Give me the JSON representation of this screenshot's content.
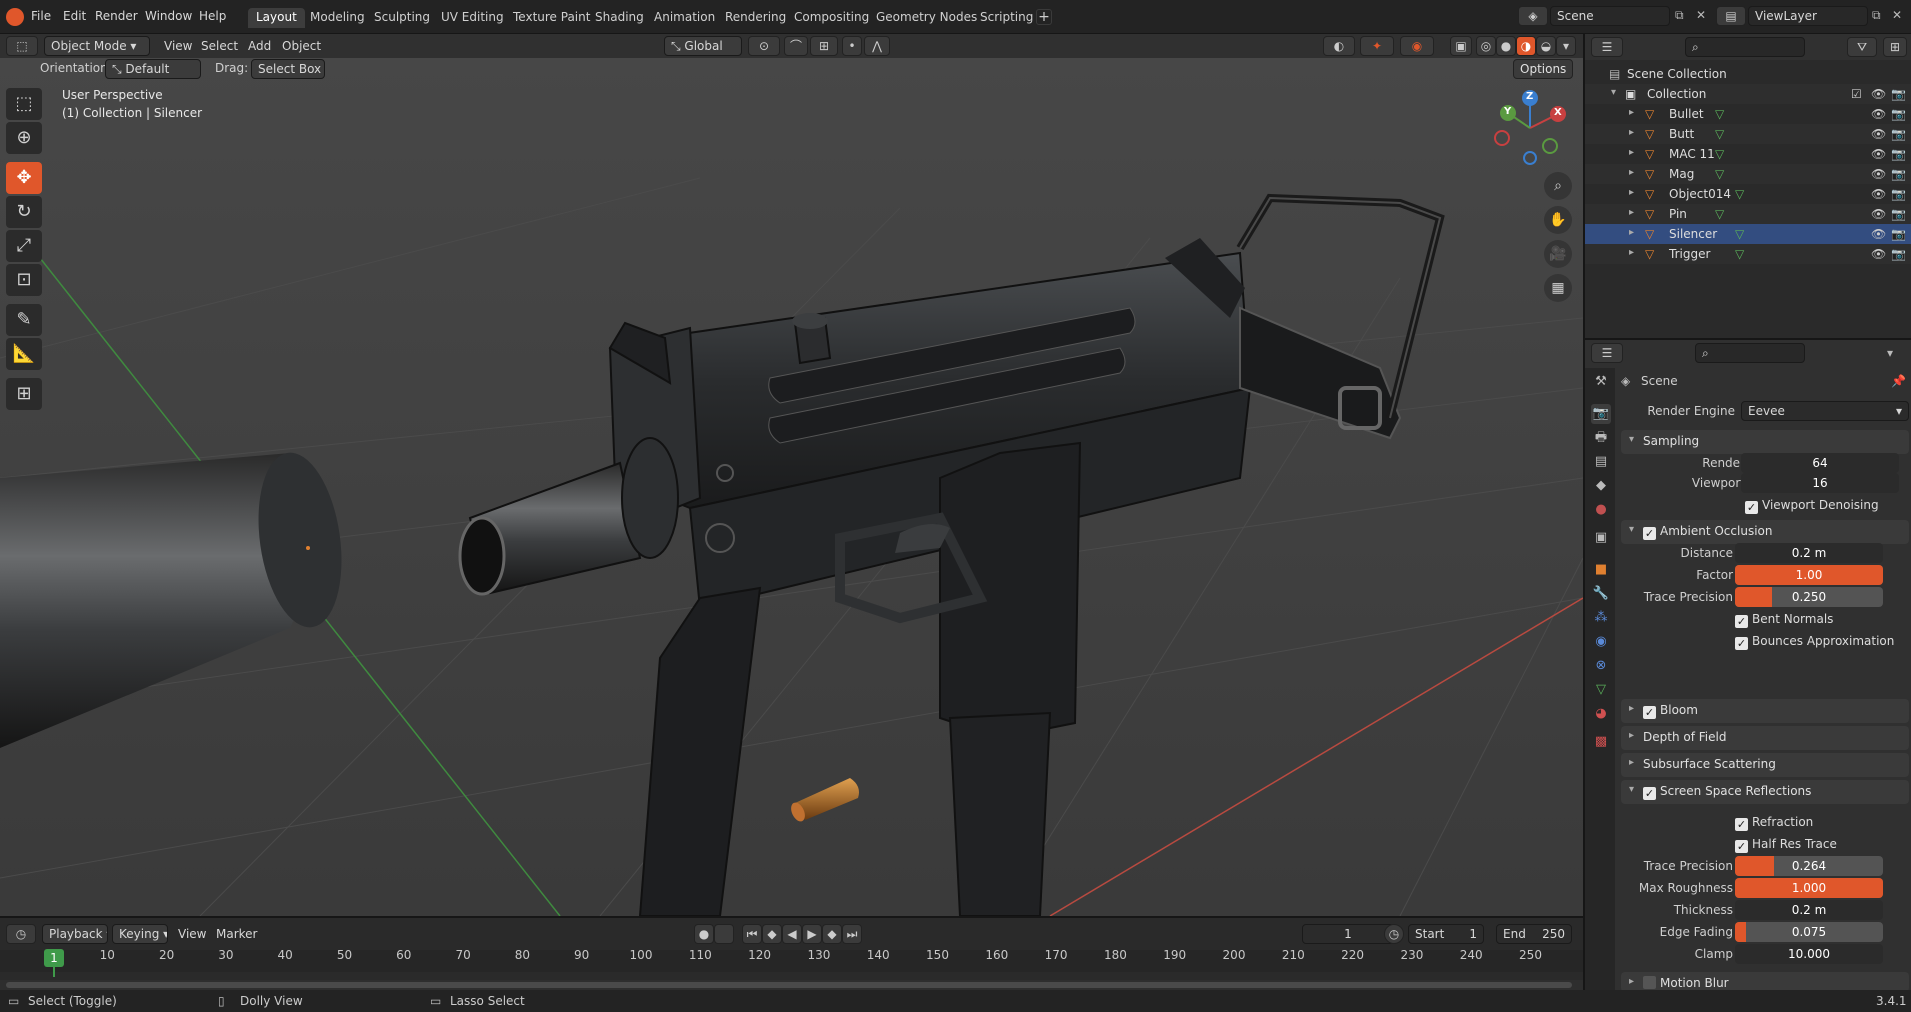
{
  "menu": [
    "File",
    "Edit",
    "Render",
    "Window",
    "Help"
  ],
  "workspaces": [
    "Layout",
    "Modeling",
    "Sculpting",
    "UV Editing",
    "Texture Paint",
    "Shading",
    "Animation",
    "Rendering",
    "Compositing",
    "Geometry Nodes",
    "Scripting"
  ],
  "active_workspace": "Layout",
  "scene_name": "Scene",
  "view_layer": "ViewLayer",
  "header": {
    "mode": "Object Mode",
    "menus": [
      "View",
      "Select",
      "Add",
      "Object"
    ],
    "transform_orientation": "Global",
    "orientation_label": "Orientation:",
    "orientation_value": "Default",
    "drag_label": "Drag:",
    "drag_value": "Select Box",
    "options": "Options"
  },
  "viewport": {
    "perspective": "User Perspective",
    "collection_info": "(1) Collection | Silencer",
    "gizmo_axes": [
      "Z",
      "Y",
      "X"
    ]
  },
  "outliner": {
    "root": "Scene Collection",
    "collection": "Collection",
    "objects": [
      "Bullet",
      "Butt",
      "MAC 11",
      "Mag",
      "Object014",
      "Pin",
      "Silencer",
      "Trigger"
    ],
    "selected": "Silencer"
  },
  "properties": {
    "context": "Scene",
    "render_engine_label": "Render Engine",
    "render_engine": "Eevee",
    "sampling": {
      "title": "Sampling",
      "render_label": "Render",
      "render": "64",
      "viewport_label": "Viewport",
      "viewport": "16",
      "denoise": "Viewport Denoising"
    },
    "ao": {
      "title": "Ambient Occlusion",
      "distance_label": "Distance",
      "distance": "0.2 m",
      "factor_label": "Factor",
      "factor": "1.00",
      "factor_fill": 1.0,
      "trace_label": "Trace Precision",
      "trace": "0.250",
      "trace_fill": 0.25,
      "bent": "Bent Normals",
      "bounces": "Bounces Approximation"
    },
    "bloom": "Bloom",
    "dof": "Depth of Field",
    "sss": "Subsurface Scattering",
    "ssr": {
      "title": "Screen Space Reflections",
      "refraction": "Refraction",
      "half_res": "Half Res Trace",
      "trace_label": "Trace Precision",
      "trace": "0.264",
      "trace_fill": 0.264,
      "rough_label": "Max Roughness",
      "rough": "1.000",
      "rough_fill": 1.0,
      "thick_label": "Thickness",
      "thick": "0.2 m",
      "edge_label": "Edge Fading",
      "edge": "0.075",
      "edge_fill": 0.075,
      "clamp_label": "Clamp",
      "clamp": "10.000"
    },
    "motion_blur": "Motion Blur"
  },
  "timeline": {
    "menus": [
      "Playback",
      "Keying",
      "View",
      "Marker"
    ],
    "current_frame": "1",
    "start_label": "Start",
    "start": "1",
    "end_label": "End",
    "end": "250",
    "ticks": [
      "1",
      "10",
      "20",
      "30",
      "40",
      "50",
      "60",
      "70",
      "80",
      "90",
      "100",
      "110",
      "120",
      "130",
      "140",
      "150",
      "160",
      "170",
      "180",
      "190",
      "200",
      "210",
      "220",
      "230",
      "240",
      "250"
    ]
  },
  "statusbar": {
    "left": "Select (Toggle)",
    "middle": "Dolly View",
    "right": "Lasso Select",
    "version": "3.4.1"
  },
  "colors": {
    "accent": "#e0572b",
    "x_axis": "#c84040",
    "y_axis": "#5a9a40",
    "z_axis": "#3a7fd0"
  }
}
